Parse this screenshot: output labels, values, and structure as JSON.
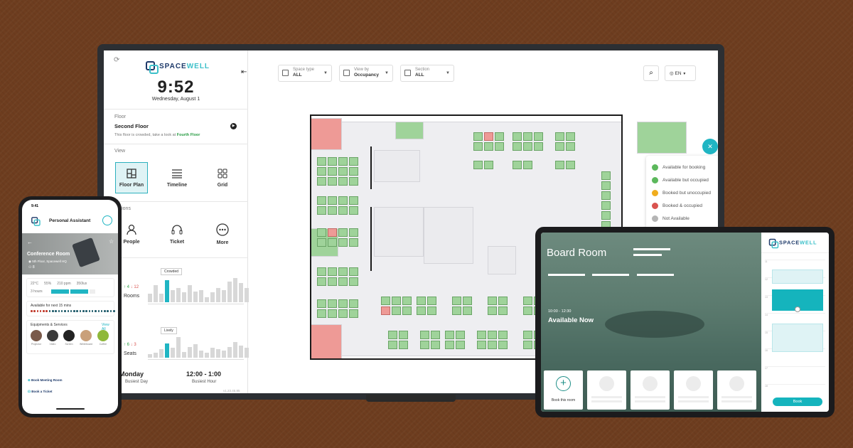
{
  "brand": {
    "logo_text_a": "SPACE",
    "logo_text_b": "WELL"
  },
  "monitor": {
    "sidebar": {
      "time": "9:52",
      "date": "Wednesday, August 1",
      "floor_label": "Floor",
      "floor_value": "Second Floor",
      "floor_note_prefix": "This floor is crowded, take a look at",
      "floor_note_link": "Fourth Floor",
      "view_label": "View",
      "views": [
        {
          "label": "Floor Plan",
          "selected": true
        },
        {
          "label": "Timeline"
        },
        {
          "label": "Grid"
        }
      ],
      "actions_label": "Actions",
      "actions": [
        {
          "label": "People"
        },
        {
          "label": "Ticket"
        },
        {
          "label": "More"
        }
      ],
      "crowded_badge": "Crowded",
      "rooms_stat_label": "Rooms",
      "rooms_up": "↑ 4",
      "rooms_down": "↓ 12",
      "lively_badge": "Lively",
      "seats_stat_label": "Seats",
      "seats_up": "↑ 6",
      "seats_down": "↓ 3",
      "busiest_day": "Monday",
      "busiest_day_label": "Busiest Day",
      "busiest_hour": "12:00 - 1:00",
      "busiest_hour_label": "Busiest Hour",
      "version": "v1.23.45.85",
      "chart_rooms": [
        0.35,
        0.7,
        0.35,
        0.9,
        0.5,
        0.6,
        0.4,
        0.7,
        0.45,
        0.5,
        0.2,
        0.4,
        0.6,
        0.5,
        0.85,
        1.0,
        0.8,
        0.6
      ],
      "chart_seats": [
        0.15,
        0.2,
        0.35,
        0.6,
        0.4,
        0.85,
        0.25,
        0.45,
        0.55,
        0.3,
        0.2,
        0.4,
        0.35,
        0.3,
        0.45,
        0.65,
        0.5,
        0.4
      ]
    },
    "filters": [
      {
        "label": "Space type",
        "value": "ALL"
      },
      {
        "label": "View by",
        "value": "Occupancy"
      },
      {
        "label": "Section",
        "value": "ALL"
      }
    ],
    "language": "EN",
    "legend": [
      {
        "label": "Available for booking",
        "color": "#5cb85c"
      },
      {
        "label": "Available but occupied",
        "color": "#5cb85c"
      },
      {
        "label": "Booked but unoccupied",
        "color": "#f0ad1e"
      },
      {
        "label": "Booked & occupied",
        "color": "#d9534f"
      },
      {
        "label": "Not Available",
        "color": "#b5b5b5"
      }
    ]
  },
  "phone": {
    "status_time": "9:41",
    "header": "Personal Assistant",
    "room_name": "Conference Room",
    "room_location": "5th Floor, Spacewell HQ",
    "room_capacity": "8",
    "sensors": [
      {
        "value": "22°C"
      },
      {
        "value": "55%"
      },
      {
        "value": "210 ppm"
      },
      {
        "value": "350lux"
      }
    ],
    "hours": "3 hours",
    "next_label": "Available for next 15 mins",
    "equip_title": "Equipments & Services",
    "view_all": "View All",
    "equipment": [
      "Projector",
      "Video",
      "Screen",
      "Whiteboard",
      "Coffee"
    ],
    "actions": [
      "Book Meeting Room",
      "Book a Ticket"
    ]
  },
  "tablet": {
    "room": "Board Room",
    "time_range": "10:00 - 12:30",
    "status": "Available Now",
    "book_this": "Book this room",
    "book_button": "Book",
    "hours": [
      "11",
      "12",
      "13",
      "14",
      "15",
      "16",
      "17",
      "18"
    ]
  }
}
